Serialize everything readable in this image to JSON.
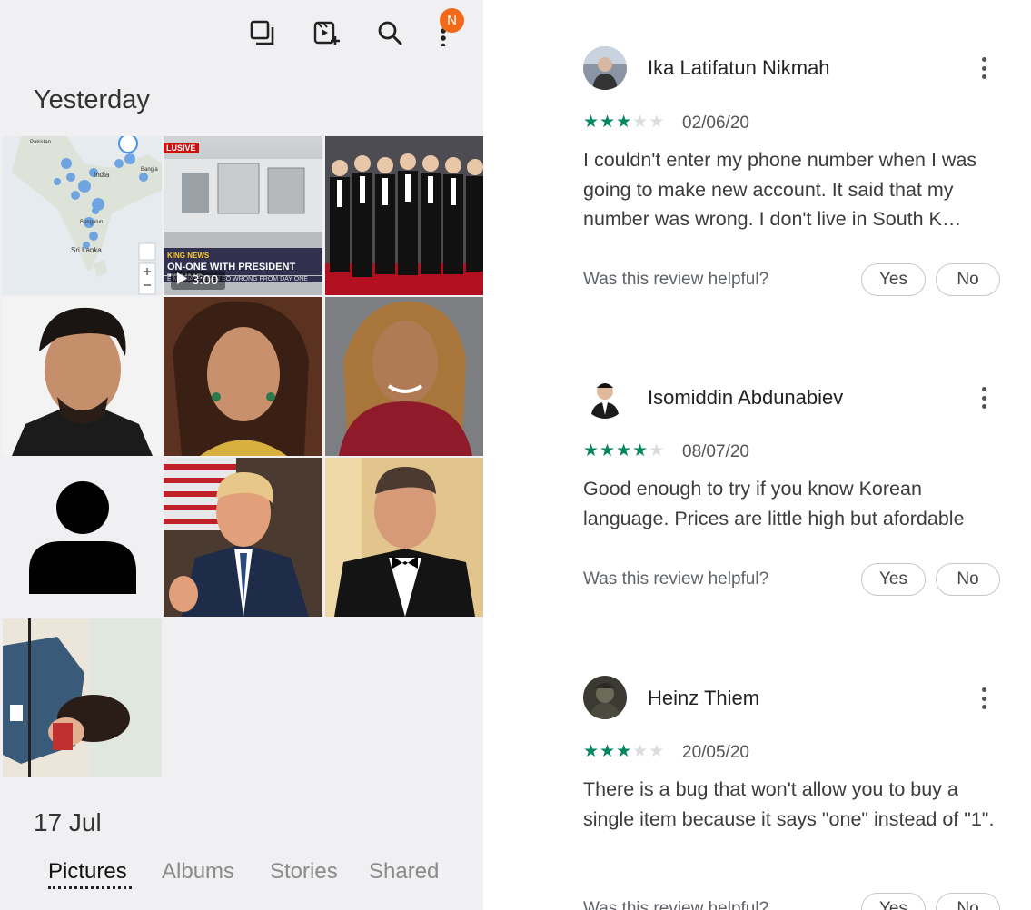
{
  "gallery": {
    "toolbar": {
      "icons": [
        "select-icon",
        "create-video-icon",
        "search-icon",
        "more-icon"
      ],
      "notification_badge": "N"
    },
    "section_title": "Yesterday",
    "tiles": [
      {
        "kind": "map",
        "labels": {
          "country_top": "Pakistan",
          "country": "India",
          "city": "Bengaluru",
          "island": "Sri Lanka",
          "bangla": "Bangla"
        }
      },
      {
        "kind": "video",
        "tag": "LUSIVE",
        "strip_top": "KING NEWS",
        "strip_main": "ON-ONE WITH PRESIDENT TRUMP",
        "strip_sub": "E MEDIA IS BEEN SO WRONG FROM DAY ONE",
        "duration": "3:00"
      },
      {
        "kind": "photo",
        "subject": "group-photo"
      },
      {
        "kind": "photo",
        "subject": "portrait-man"
      },
      {
        "kind": "photo",
        "subject": "portrait-woman"
      },
      {
        "kind": "photo",
        "subject": "portrait-woman-2"
      },
      {
        "kind": "placeholder",
        "subject": "person-placeholder"
      },
      {
        "kind": "photo",
        "subject": "portrait-man-2"
      },
      {
        "kind": "photo",
        "subject": "portrait-man-3"
      },
      {
        "kind": "photo",
        "subject": "rotated-photo"
      }
    ],
    "date_label": "17 Jul",
    "tabs": [
      {
        "label": "Pictures",
        "active": true
      },
      {
        "label": "Albums",
        "active": false
      },
      {
        "label": "Stories",
        "active": false
      },
      {
        "label": "Shared",
        "active": false
      }
    ]
  },
  "reviews": {
    "helpful_prompt": "Was this review helpful?",
    "yes_label": "Yes",
    "no_label": "No",
    "star_color": "#01875f",
    "items": [
      {
        "name": "Ika Latifatun Nikmah",
        "rating": 3,
        "date": "02/06/20",
        "text": "I couldn't enter my phone number when I was going to make new account. It said that my number was wrong. I don't live in South K…"
      },
      {
        "name": "Isomiddin Abdunabiev",
        "rating": 4,
        "date": "08/07/20",
        "text": "Good enough to try if you know Korean language. Prices are little high but afordable"
      },
      {
        "name": "Heinz Thiem",
        "rating": 3,
        "date": "20/05/20",
        "text": "There is a bug that won't allow you to buy a single item because it says \"one\" instead of \"1\"."
      }
    ]
  }
}
